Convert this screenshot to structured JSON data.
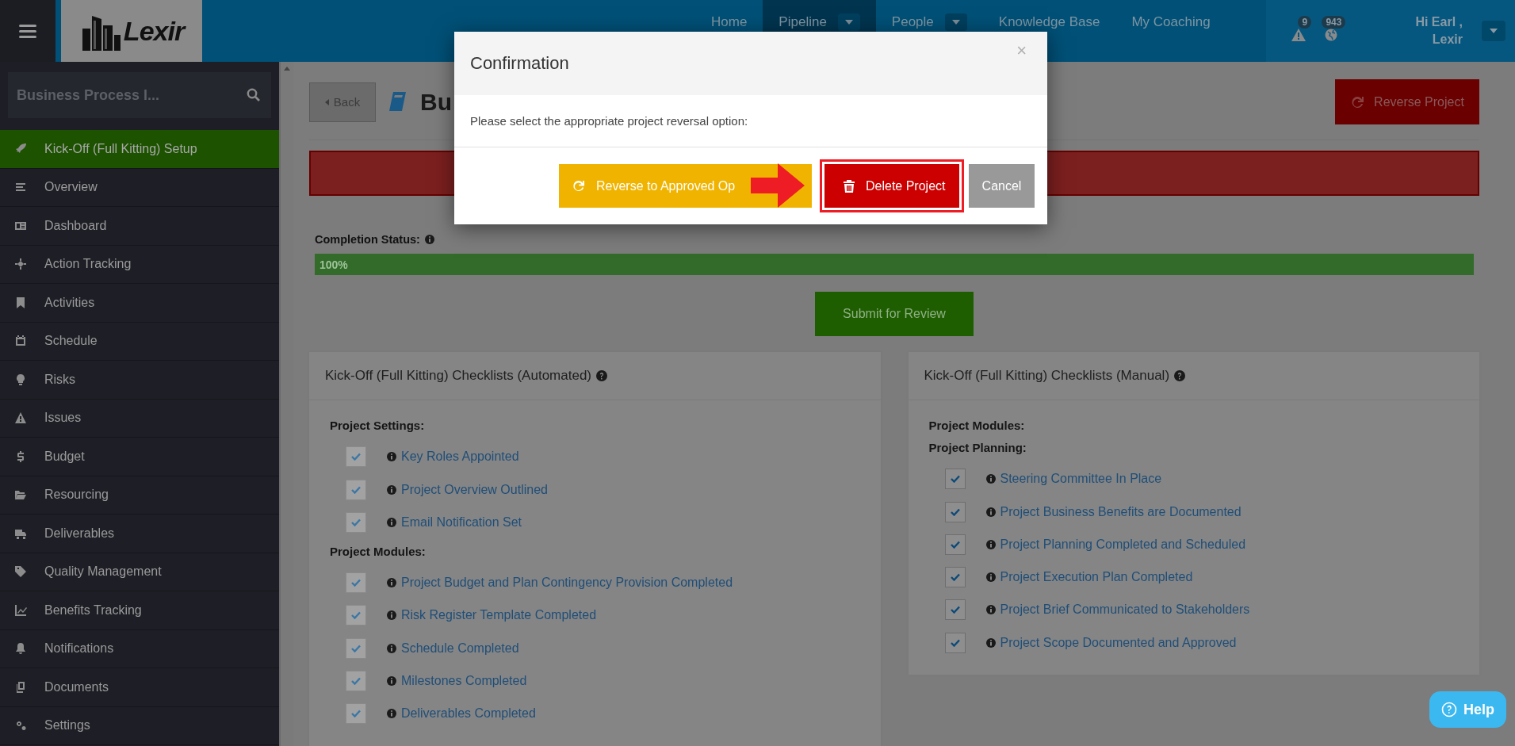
{
  "header": {
    "brand": "Lexir",
    "nav": [
      {
        "label": "Home",
        "dropdown": false,
        "selected": false
      },
      {
        "label": "Pipeline",
        "dropdown": true,
        "selected": true
      },
      {
        "label": "People",
        "dropdown": true,
        "selected": false
      },
      {
        "label": "Knowledge Base",
        "dropdown": false,
        "selected": false
      },
      {
        "label": "My Coaching",
        "dropdown": false,
        "selected": false
      }
    ],
    "alerts": [
      {
        "kind": "warning",
        "count": "9"
      },
      {
        "kind": "globe",
        "count": "943"
      }
    ],
    "user": {
      "greeting": "Hi Earl ,",
      "name": "Lexir"
    }
  },
  "sidebar": {
    "search": {
      "value": "Business Process I..."
    },
    "items": [
      {
        "label": "Kick-Off (Full Kitting) Setup",
        "selected": true
      },
      {
        "label": "Overview",
        "selected": false
      },
      {
        "label": "Dashboard",
        "selected": false
      },
      {
        "label": "Action Tracking",
        "selected": false
      },
      {
        "label": "Activities",
        "selected": false
      },
      {
        "label": "Schedule",
        "selected": false
      },
      {
        "label": "Risks",
        "selected": false
      },
      {
        "label": "Issues",
        "selected": false
      },
      {
        "label": "Budget",
        "selected": false
      },
      {
        "label": "Resourcing",
        "selected": false
      },
      {
        "label": "Deliverables",
        "selected": false
      },
      {
        "label": "Quality Management",
        "selected": false
      },
      {
        "label": "Benefits Tracking",
        "selected": false
      },
      {
        "label": "Notifications",
        "selected": false
      },
      {
        "label": "Documents",
        "selected": false
      },
      {
        "label": "Settings",
        "selected": false
      }
    ]
  },
  "page": {
    "back": "Back",
    "title": "Bu",
    "reverse_button": "Reverse Project",
    "completion": {
      "label": "Completion Status:",
      "level": 1,
      "reading": "100%"
    },
    "submit": "Submit for Review"
  },
  "cards": [
    {
      "title": "Kick-Off (Full Kitting) Checklists (Automated)",
      "sections": [
        {
          "heading": "Project Settings:",
          "items": [
            {
              "label": "Key Roles Appointed",
              "checked": true,
              "disabled": true
            },
            {
              "label": "Project Overview Outlined",
              "checked": true,
              "disabled": true
            },
            {
              "label": "Email Notification Set",
              "checked": true,
              "disabled": true
            }
          ]
        },
        {
          "heading": "Project Modules:",
          "items": [
            {
              "label": "Project Budget and Plan Contingency Provision Completed",
              "checked": true,
              "disabled": true
            },
            {
              "label": "Risk Register Template Completed",
              "checked": true,
              "disabled": true
            },
            {
              "label": "Schedule Completed",
              "checked": true,
              "disabled": true
            },
            {
              "label": "Milestones Completed",
              "checked": true,
              "disabled": true
            },
            {
              "label": "Deliverables Completed",
              "checked": true,
              "disabled": true
            }
          ]
        }
      ]
    },
    {
      "title": "Kick-Off (Full Kitting) Checklists (Manual)",
      "sections": [
        {
          "heading": "Project Modules:"
        },
        {
          "heading": "Project Planning:",
          "items": [
            {
              "label": "Steering Committee In Place",
              "checked": true,
              "disabled": false
            },
            {
              "label": "Project Business Benefits are Documented",
              "checked": true,
              "disabled": false
            },
            {
              "label": "Project Planning Completed and Scheduled",
              "checked": true,
              "disabled": false
            },
            {
              "label": "Project Execution Plan Completed",
              "checked": true,
              "disabled": false
            },
            {
              "label": "Project Brief Communicated to Stakeholders",
              "checked": true,
              "disabled": false
            },
            {
              "label": "Project Scope Documented and Approved",
              "checked": true,
              "disabled": false
            }
          ]
        }
      ]
    }
  ],
  "modal": {
    "title": "Confirmation",
    "close": "×",
    "message": "Please select the appropriate project reversal option:",
    "buttons": [
      {
        "kind": "reverse",
        "label": "Reverse to Approved Op"
      },
      {
        "kind": "delete",
        "label": "Delete Project",
        "highlighted": true
      },
      {
        "kind": "cancel",
        "label": "Cancel"
      }
    ]
  },
  "help": "Help"
}
